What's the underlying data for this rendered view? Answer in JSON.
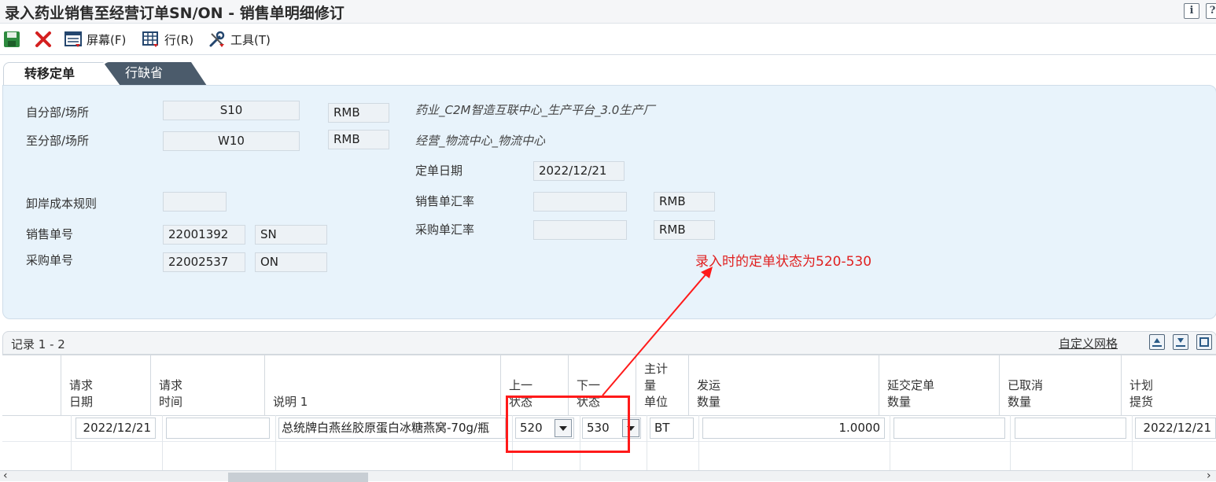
{
  "window": {
    "title": "录入药业销售至经营订单SN/ON - 销售单明细修订",
    "info_icon": "info-icon",
    "help_icon": "help-icon"
  },
  "toolbar": {
    "save": "save-icon",
    "cancel": "close-icon",
    "screen_label": "屏幕(F)",
    "row_label": "行(R)",
    "tools_label": "工具(T)"
  },
  "tabs": [
    {
      "label": "转移定单",
      "active": true
    },
    {
      "label": "行缺省",
      "active": false
    }
  ],
  "form": {
    "from_branch_label": "自分部/场所",
    "from_branch_value": "S10",
    "from_currency": "RMB",
    "from_desc": "药业_C2M智造互联中心_生产平台_3.0生产厂",
    "to_branch_label": "至分部/场所",
    "to_branch_value": "W10",
    "to_currency": "RMB",
    "to_desc": "经营_物流中心_物流中心",
    "order_date_label": "定单日期",
    "order_date_value": "2022/12/21",
    "landed_cost_label": "卸岸成本规则",
    "landed_cost_value": "",
    "sales_rate_label": "销售单汇率",
    "sales_rate_value": "",
    "sales_rate_currency": "RMB",
    "purchase_rate_label": "采购单汇率",
    "purchase_rate_value": "",
    "purchase_rate_currency": "RMB",
    "sales_no_label": "销售单号",
    "sales_no_value": "22001392",
    "sales_no_type": "SN",
    "purchase_no_label": "采购单号",
    "purchase_no_value": "22002537",
    "purchase_no_type": "ON"
  },
  "annotation": {
    "text": "录入时的定单状态为520-530",
    "color": "#e02020"
  },
  "grid": {
    "records": "记录 1 - 2",
    "customize": "自定义网格",
    "columns": [
      "",
      "请求\n日期",
      "请求\n时间",
      "说明 1",
      "上一\n状态",
      "下一\n状态",
      "主计\n量\n单位",
      "发运\n数量",
      "延交定单\n数量",
      "已取消\n数量",
      "计划\n提货"
    ],
    "row1": {
      "req_date": "2022/12/21",
      "req_time": "",
      "desc": "总统牌白燕丝胶原蛋白冰糖燕窝-70g/瓶",
      "last_status": "520",
      "next_status": "530",
      "uom": "BT",
      "ship_qty": "1.0000",
      "backorder_qty": "",
      "cancel_qty": "",
      "plan_pickup": "2022/12/21"
    }
  },
  "colors": {
    "panel_bg": "#e8f3fb",
    "tab_dark": "#4b5b6b",
    "highlight": "#ff1a1a"
  }
}
